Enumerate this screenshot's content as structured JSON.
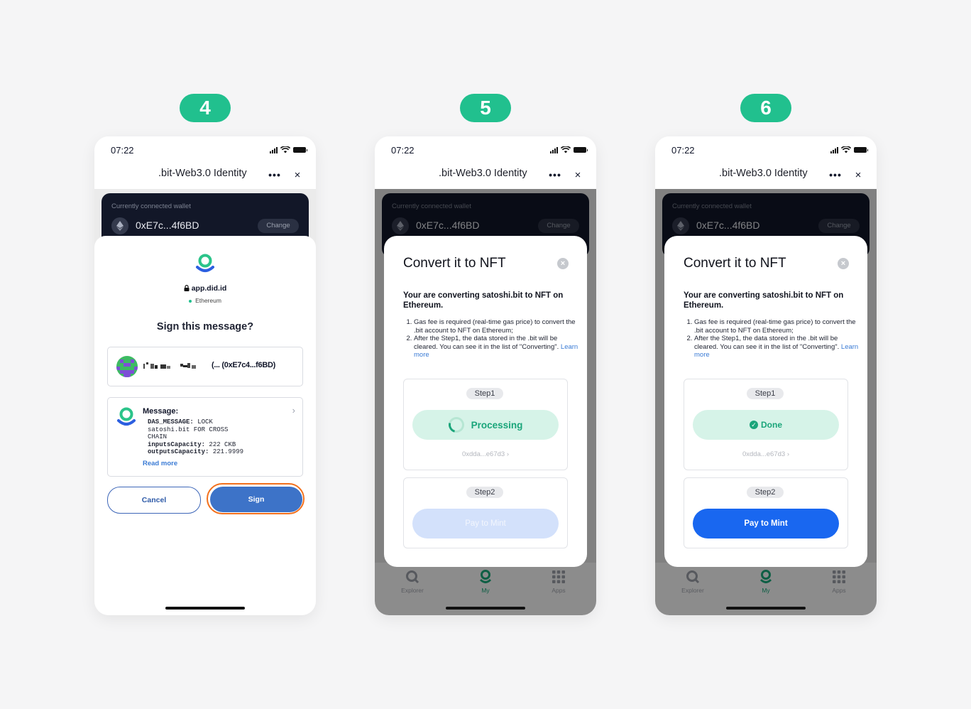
{
  "steps": [
    "4",
    "5",
    "6"
  ],
  "device": {
    "time": "07:22",
    "nav_title": ".bit-Web3.0 Identity",
    "more_icon": "•••",
    "close_icon": "×"
  },
  "wallet": {
    "caption": "Currently connected wallet",
    "address": "0xE7c...4f6BD",
    "change_label": "Change"
  },
  "tabbar": {
    "explorer": "Explorer",
    "my": "My",
    "apps": "Apps"
  },
  "sign_sheet": {
    "origin": "app.did.id",
    "chain": "Ethereum",
    "title": "Sign this message?",
    "account_address": "(... (0xE7c4...f6BD)",
    "message_label": "Message:",
    "message_lines": [
      {
        "key": "DAS_MESSAGE:",
        "val": " LOCK"
      },
      {
        "key": "",
        "val": "satoshi.bit FOR CROSS"
      },
      {
        "key": "",
        "val": "CHAIN"
      },
      {
        "key": "inputsCapacity:",
        "val": " 222 CKB"
      },
      {
        "key": "outputsCapacity:",
        "val": " 221.9999"
      }
    ],
    "read_more": "Read more",
    "cancel_label": "Cancel",
    "sign_label": "Sign"
  },
  "nft_modal": {
    "title": "Convert it to NFT",
    "lead": "Your are converting satoshi.bit to NFT on Ethereum.",
    "item1": "Gas fee is required (real-time gas price) to convert the .bit account to NFT on Ethereum;",
    "item2": "After the Step1, the data stored in the .bit will be cleared. You can see it in the list of \"Converting\".",
    "learn_more": "Learn more",
    "step1_label": "Step1",
    "step2_label": "Step2",
    "processing_label": "Processing",
    "done_label": "Done",
    "tx_hash": "0xdda...e67d3",
    "pay_to_mint": "Pay  to Mint"
  },
  "colors": {
    "badge": "#21c08e",
    "sign_highlight": "#f3701c",
    "primary_blue": "#1967f0",
    "success": "#1aa57a"
  }
}
